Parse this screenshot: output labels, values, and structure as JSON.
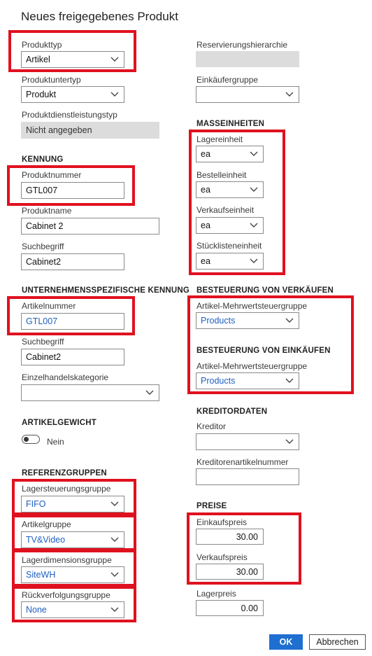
{
  "dialog": {
    "title": "Neues freigegebenes Produkt"
  },
  "left": {
    "produkttyp": {
      "label": "Produkttyp",
      "value": "Artikel"
    },
    "produktuntertyp": {
      "label": "Produktuntertyp",
      "value": "Produkt"
    },
    "produktdienstleistungstyp": {
      "label": "Produktdienstleistungstyp",
      "value": "Nicht angegeben"
    },
    "kennung": {
      "header": "KENNUNG",
      "produktnummer": {
        "label": "Produktnummer",
        "value": "GTL007"
      },
      "produktname": {
        "label": "Produktname",
        "value": "Cabinet 2"
      },
      "suchbegriff": {
        "label": "Suchbegriff",
        "value": "Cabinet2"
      }
    },
    "unternehmen": {
      "header": "UNTERNEHMENSSPEZIFISCHE KENNUNG",
      "artikelnummer": {
        "label": "Artikelnummer",
        "value": "GTL007"
      },
      "suchbegriff": {
        "label": "Suchbegriff",
        "value": "Cabinet2"
      },
      "einzelhandelskategorie": {
        "label": "Einzelhandelskategorie",
        "value": ""
      }
    },
    "artikelgewicht": {
      "header": "ARTIKELGEWICHT",
      "toggle_label": "Nein"
    },
    "referenzgruppen": {
      "header": "REFERENZGRUPPEN",
      "lagersteuerungsgruppe": {
        "label": "Lagersteuerungsgruppe",
        "value": "FIFO"
      },
      "artikelgruppe": {
        "label": "Artikelgruppe",
        "value": "TV&Video"
      },
      "lagerdimensionsgruppe": {
        "label": "Lagerdimensionsgruppe",
        "value": "SiteWH"
      },
      "rueckverfolgungsgruppe": {
        "label": "Rückverfolgungsgruppe",
        "value": "None"
      }
    }
  },
  "right": {
    "reservierungshierarchie": {
      "label": "Reservierungshierarchie",
      "value": ""
    },
    "einkaeufergruppe": {
      "label": "Einkäufergruppe",
      "value": ""
    },
    "masseinheiten": {
      "header": "MASSEINHEITEN",
      "lagereinheit": {
        "label": "Lagereinheit",
        "value": "ea"
      },
      "bestelleinheit": {
        "label": "Bestelleinheit",
        "value": "ea"
      },
      "verkaufseinheit": {
        "label": "Verkaufseinheit",
        "value": "ea"
      },
      "stuecklisteneinheit": {
        "label": "Stücklisteneinheit",
        "value": "ea"
      }
    },
    "besteuerung_verkauf": {
      "header": "BESTEUERUNG VON VERKÄUFEN",
      "label": "Artikel-Mehrwertsteuergruppe",
      "value": "Products"
    },
    "besteuerung_einkauf": {
      "header": "BESTEUERUNG VON EINKÄUFEN",
      "label": "Artikel-Mehrwertsteuergruppe",
      "value": "Products"
    },
    "kreditordaten": {
      "header": "KREDITORDATEN",
      "kreditor": {
        "label": "Kreditor",
        "value": ""
      },
      "kreditorenartikelnummer": {
        "label": "Kreditorenartikelnummer",
        "value": ""
      }
    },
    "preise": {
      "header": "PREISE",
      "einkaufspreis": {
        "label": "Einkaufspreis",
        "value": "30.00"
      },
      "verkaufspreis": {
        "label": "Verkaufspreis",
        "value": "30.00"
      },
      "lagerpreis": {
        "label": "Lagerpreis",
        "value": "0.00"
      }
    }
  },
  "footer": {
    "ok_label": "OK",
    "cancel_label": "Abbrechen"
  },
  "colors": {
    "highlight": "#e0111f",
    "accent": "#1f6fd1",
    "link_value": "#1f5fbf"
  }
}
